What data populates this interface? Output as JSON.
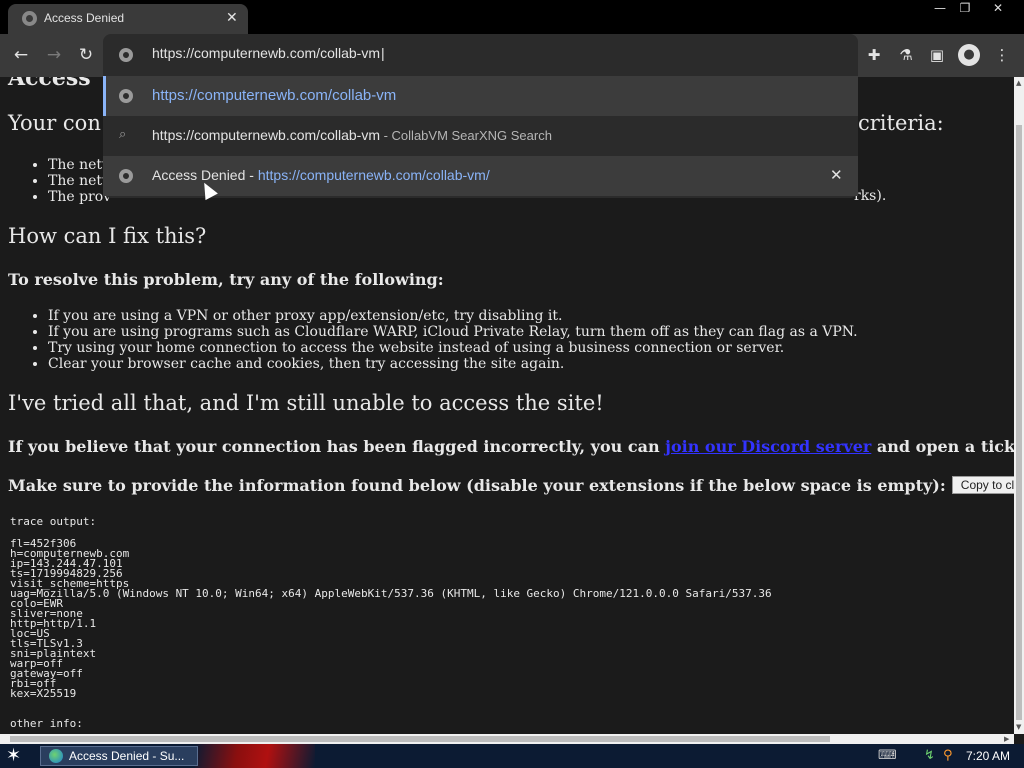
{
  "browser": {
    "tab_title": "Access Denied",
    "tab_close": "✕",
    "window_controls": {
      "minimize": "—",
      "restore": "❐",
      "close": "✕"
    },
    "nav": {
      "back": "←",
      "forward": "→",
      "reload": "↻"
    },
    "toolbar_icons": [
      "puzzle-icon",
      "flask-icon",
      "sidebar-icon",
      "profile-icon",
      "menu-icon"
    ]
  },
  "omnibox": {
    "input_value": "https://computernewb.com/collab-vm",
    "suggestions": [
      {
        "kind": "url",
        "url": "https://computernewb.com/collab-vm"
      },
      {
        "kind": "search",
        "query": "https://computernewb.com/collab-vm",
        "sep": " - ",
        "engine": "CollabVM SearXNG Search"
      },
      {
        "kind": "history",
        "title": "Access Denied",
        "sep": " - ",
        "url": "https://computernewb.com/collab-vm/",
        "remove": "✕"
      }
    ]
  },
  "page": {
    "partial_heading": "Access",
    "partial_criteria_left": "Your con",
    "partial_criteria_right": "criteria:",
    "partial_items": [
      "The netw",
      "The netw",
      "The prov"
    ],
    "partial_item_tail": "rks).",
    "fix_heading": "How can I fix this?",
    "resolve_heading": "To resolve this problem, try any of the following:",
    "resolve_items": [
      "If you are using a VPN or other proxy app/extension/etc, try disabling it.",
      "If you are using programs such as Cloudflare WARP, iCloud Private Relay, turn them off as they can flag as a VPN.",
      "Try using your home connection to access the website instead of using a business connection or server.",
      "Clear your browser cache and cookies, then try accessing the site again."
    ],
    "tried_heading": "I've tried all that, and I'm still unable to access the site!",
    "flagged_pre": "If you believe that your connection has been flagged incorrectly, you can ",
    "flagged_link": "join our Discord server",
    "flagged_post": " and open a ticket.",
    "provide_text": "Make sure to provide the information found below (disable your extensions if the below space is empty):",
    "copy_button": "Copy to clipboard",
    "trace_header": "trace output:",
    "trace_lines": [
      "fl=452f306",
      "h=computernewb.com",
      "ip=143.244.47.101",
      "ts=1719994829.256",
      "visit_scheme=https",
      "uag=Mozilla/5.0 (Windows NT 10.0; Win64; x64) AppleWebKit/537.36 (KHTML, like Gecko) Chrome/121.0.0.0 Safari/537.36",
      "colo=EWR",
      "sliver=none",
      "http=http/1.1",
      "loc=US",
      "tls=TLSv1.3",
      "sni=plaintext",
      "warp=off",
      "gateway=off",
      "rbi=off",
      "kex=X25519"
    ],
    "other_info": "other info:"
  },
  "taskbar": {
    "start": "✶",
    "task_item": "Access Denied - Su...",
    "clock": "7:20 AM",
    "tray_icons": [
      "keyboard-icon",
      "network-icon",
      "search-icon"
    ]
  }
}
